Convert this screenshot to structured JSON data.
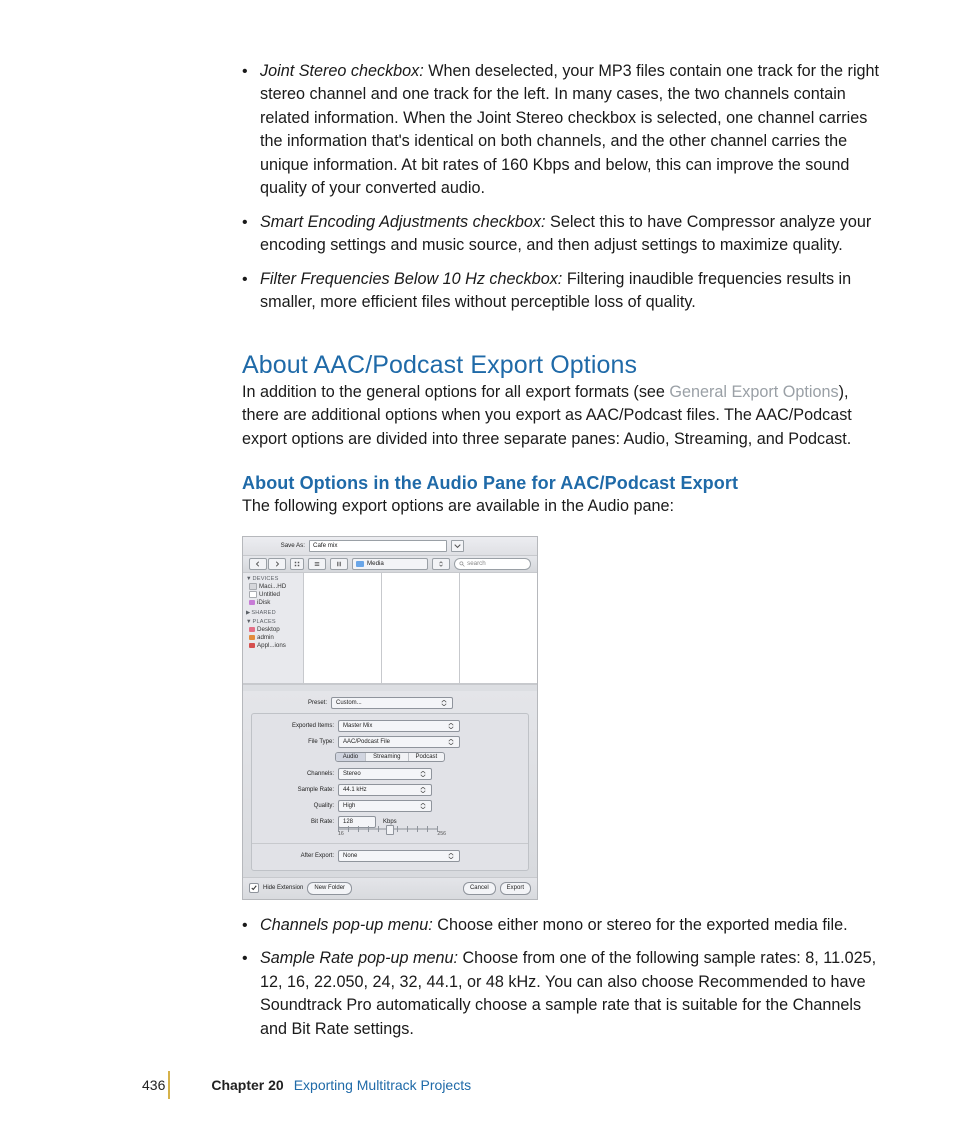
{
  "top_items": [
    {
      "title": "Joint Stereo checkbox:",
      "body": "When deselected, your MP3 files contain one track for the right stereo channel and one track for the left. In many cases, the two channels contain related information. When the Joint Stereo checkbox is selected, one channel carries the information that's identical on both channels, and the other channel carries the unique information. At bit rates of 160 Kbps and below, this can improve the sound quality of your converted audio."
    },
    {
      "title": "Smart Encoding Adjustments checkbox:",
      "body": "Select this to have Compressor analyze your encoding settings and music source, and then adjust settings to maximize quality."
    },
    {
      "title": "Filter Frequencies Below 10 Hz checkbox:",
      "body": "Filtering inaudible frequencies results in smaller, more efficient files without perceptible loss of quality."
    }
  ],
  "section": {
    "heading": "About AAC/Podcast Export Options",
    "para_pre": "In addition to the general options for all export formats (see ",
    "link": "General Export Options",
    "para_post": "), there are additional options when you export as AAC/Podcast files. The AAC/Podcast export options are divided into three separate panes: Audio, Streaming, and Podcast.",
    "sub_heading": "About Options in the Audio Pane for AAC/Podcast Export",
    "sub_para": "The following export options are available in the Audio pane:"
  },
  "dialog": {
    "save_as_label": "Save As:",
    "save_as_value": "Cafe mix",
    "path_label": "Media",
    "search_placeholder": "search",
    "sidebar": {
      "devices_head": "DEVICES",
      "devices": [
        {
          "label": "Maci...HD"
        },
        {
          "label": "Untitled"
        },
        {
          "label": "iDisk"
        }
      ],
      "shared_head": "SHARED",
      "places_head": "PLACES",
      "places": [
        {
          "label": "Desktop"
        },
        {
          "label": "admin"
        },
        {
          "label": "Appl...ions"
        }
      ]
    },
    "form": {
      "preset_label": "Preset:",
      "preset_value": "Custom...",
      "exported_label": "Exported Items:",
      "exported_value": "Master Mix",
      "filetype_label": "File Type:",
      "filetype_value": "AAC/Podcast File",
      "tabs": [
        "Audio",
        "Streaming",
        "Podcast"
      ],
      "channels_label": "Channels:",
      "channels_value": "Stereo",
      "samplerate_label": "Sample Rate:",
      "samplerate_value": "44.1 kHz",
      "quality_label": "Quality:",
      "quality_value": "High",
      "bitrate_label": "Bit Rate:",
      "bitrate_value": "128",
      "bitrate_unit": "Kbps",
      "slider_min": "16",
      "slider_max": "256",
      "after_label": "After Export:",
      "after_value": "None"
    },
    "bottom": {
      "hide_ext": "Hide Extension",
      "new_folder": "New Folder",
      "cancel": "Cancel",
      "export": "Export"
    }
  },
  "bot_items": [
    {
      "title": "Channels pop-up menu:",
      "body": "Choose either mono or stereo for the exported media file."
    },
    {
      "title": "Sample Rate pop-up menu:",
      "body": "Choose from one of the following sample rates: 8, 11.025, 12, 16, 22.050, 24, 32, 44.1, or 48 kHz. You can also choose Recommended to have Soundtrack Pro automatically choose a sample rate that is suitable for the Channels and Bit Rate settings."
    }
  ],
  "footer": {
    "page": "436",
    "chapter": "Chapter 20",
    "title": "Exporting Multitrack Projects"
  }
}
